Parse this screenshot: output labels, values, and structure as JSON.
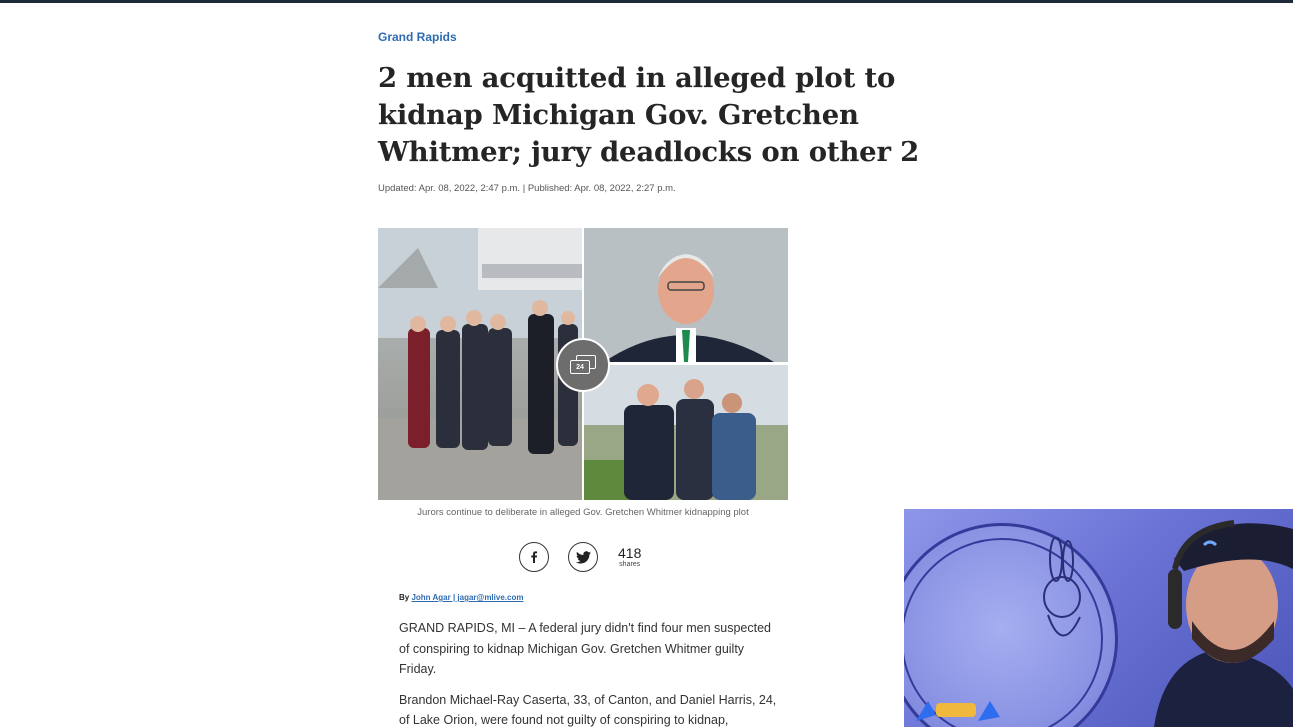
{
  "article": {
    "section": "Grand Rapids",
    "headline": "2 men acquitted in alleged plot to kidnap Michigan Gov. Gretchen Whitmer; jury deadlocks on other 2",
    "dateline": "Updated: Apr. 08, 2022, 2:47 p.m. | Published: Apr. 08, 2022, 2:27 p.m.",
    "gallery_count": "24",
    "caption": "Jurors continue to deliberate in alleged Gov. Gretchen Whitmer kidnapping plot",
    "shares": {
      "count": "418",
      "label": "shares"
    },
    "byline": {
      "prefix": "By ",
      "author": "John Agar | jagar@mlive.com"
    },
    "paragraphs": [
      "GRAND RAPIDS, MI – A federal jury didn't find four men suspected of conspiring to kidnap Michigan Gov. Gretchen Whitmer guilty Friday.",
      "Brandon Michael-Ray Caserta, 33, of Canton, and Daniel Harris, 24, of Lake Orion, were found not guilty of conspiring to kidnap,"
    ]
  },
  "icons": {
    "gallery": "gallery-stack-icon",
    "facebook": "facebook-icon",
    "twitter": "twitter-icon"
  },
  "colors": {
    "link": "#2f6bb3",
    "top_bar": "#1c2a3a",
    "webcam_tint": "#6b74d6"
  }
}
